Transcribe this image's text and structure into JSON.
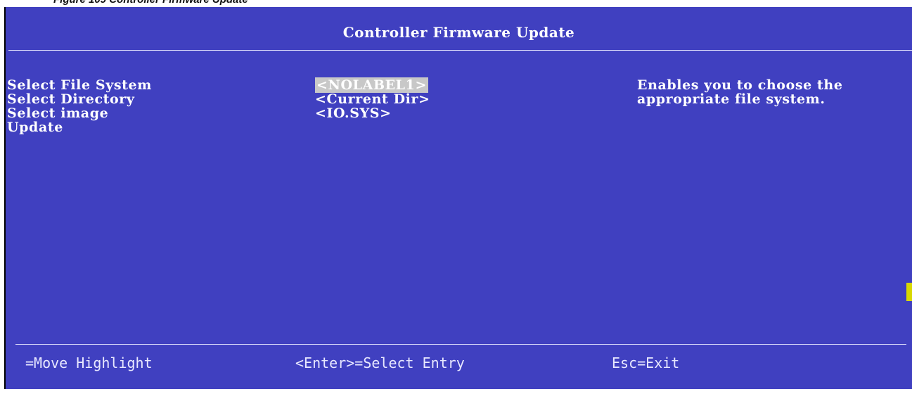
{
  "caption": "Figure 109 Controller Firmware Update",
  "window": {
    "title": "Controller Firmware Update"
  },
  "menu": {
    "items": [
      {
        "label": "Select File System",
        "value": "<NOLABEL1>"
      },
      {
        "label": "Select Directory",
        "value": "<Current Dir>"
      },
      {
        "label": "Select image",
        "value": "<IO.SYS>"
      },
      {
        "label": "Update",
        "value": ""
      }
    ],
    "selected_index": 0
  },
  "help": {
    "text": "Enables you to choose the appropriate file system."
  },
  "footer": {
    "move": "=Move Highlight",
    "enter": "<Enter>=Select Entry",
    "esc": "Esc=Exit"
  },
  "colors": {
    "background": "#4040c0",
    "text": "#ffffff",
    "highlight": "#c8c8c8",
    "marker": "#d8d800"
  }
}
